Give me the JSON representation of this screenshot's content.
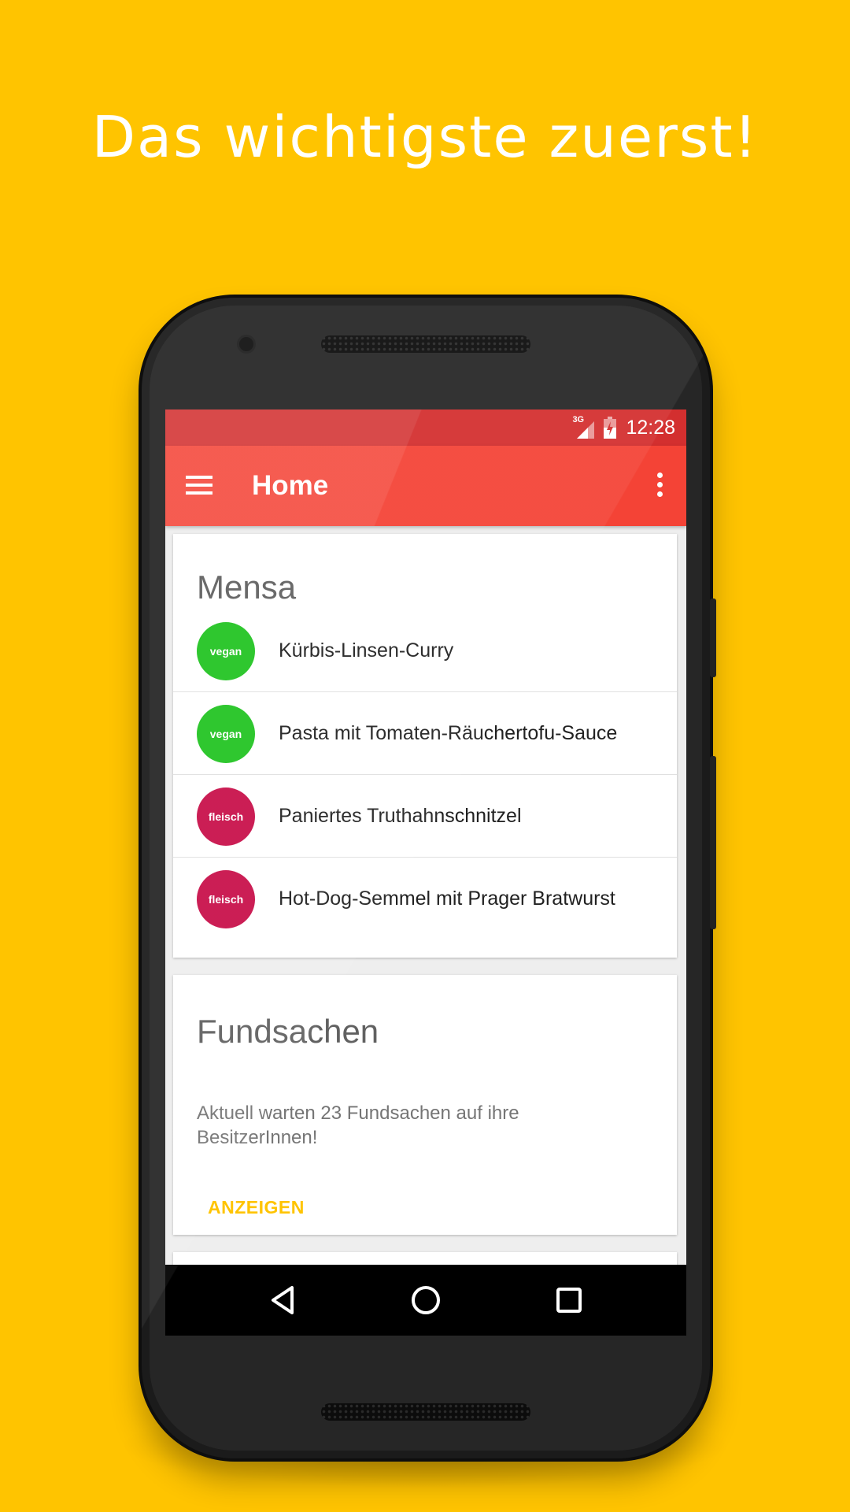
{
  "promo": {
    "headline": "Das wichtigste zuerst!"
  },
  "status_bar": {
    "network": "3G",
    "time": "12:28"
  },
  "app_bar": {
    "title": "Home"
  },
  "colors": {
    "background": "#FFC400",
    "app_bar": "#F44336",
    "status_bar": "#D32F2F",
    "vegan": "#22C422",
    "fleisch": "#C8104A",
    "accent": "#FFC400"
  },
  "mensa": {
    "title": "Mensa",
    "meals": [
      {
        "tag": "vegan",
        "name": "Kürbis-Linsen-Curry"
      },
      {
        "tag": "vegan",
        "name": "Pasta mit Tomaten-Räuchertofu-Sauce"
      },
      {
        "tag": "fleisch",
        "name": "Paniertes Truthahnschnitzel"
      },
      {
        "tag": "fleisch",
        "name": "Hot-Dog-Semmel mit Prager Bratwurst"
      }
    ]
  },
  "fundsachen": {
    "title": "Fundsachen",
    "text": "Aktuell warten 23 Fundsachen auf ihre BesitzerInnen!",
    "action": "ANZEIGEN"
  },
  "nav": {
    "back_icon": "back-triangle-icon",
    "home_icon": "home-circle-icon",
    "recents_icon": "recents-square-icon"
  }
}
